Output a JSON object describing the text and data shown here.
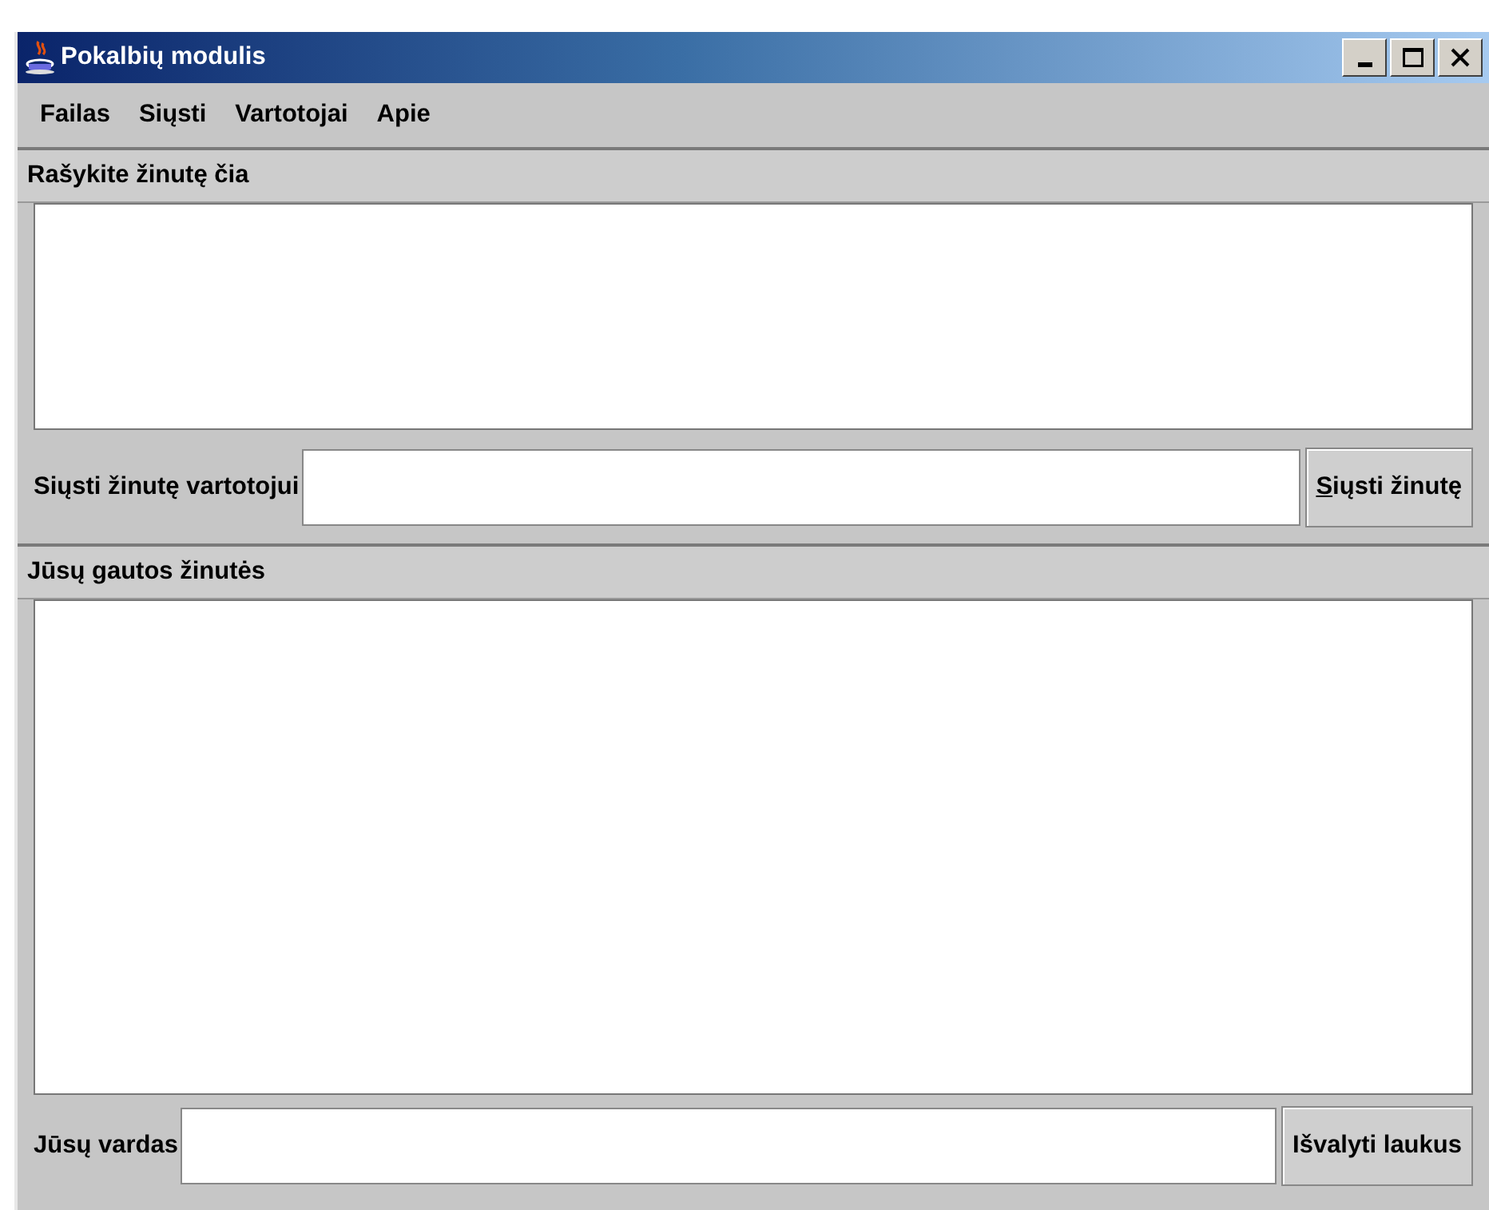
{
  "window": {
    "title": "Pokalbių modulis"
  },
  "menu": [
    "Failas",
    "Siųsti",
    "Vartotojai",
    "Apie"
  ],
  "compose": {
    "header": "Rašykite žinutę čia",
    "recipient_label": "Siųsti žinutę vartotojui",
    "send_button": {
      "label": "Siųsti žinutę",
      "mnemonic": true
    }
  },
  "received": {
    "header": "Jūsų gautos žinutės",
    "name_label": "Jūsų vardas",
    "clear_button": {
      "label": "Išvalyti laukus",
      "mnemonic": false
    }
  }
}
